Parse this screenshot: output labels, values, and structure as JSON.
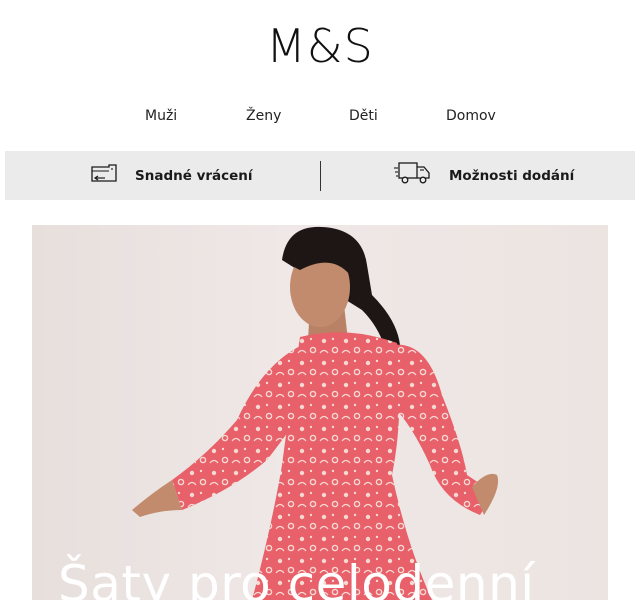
{
  "brand": {
    "logo": "M&S"
  },
  "nav": {
    "items": [
      "Muži",
      "Ženy",
      "Děti",
      "Domov"
    ]
  },
  "promo": {
    "returns_label": "Snadné vrácení",
    "delivery_label": "Možnosti dodání"
  },
  "hero": {
    "heading": "Šaty pro celodenní"
  },
  "colors": {
    "promo_bg": "#ebebeb",
    "dress": "#e8606a",
    "text": "#111111"
  },
  "icons": {
    "returns": "return-box-icon",
    "delivery": "delivery-truck-icon"
  }
}
